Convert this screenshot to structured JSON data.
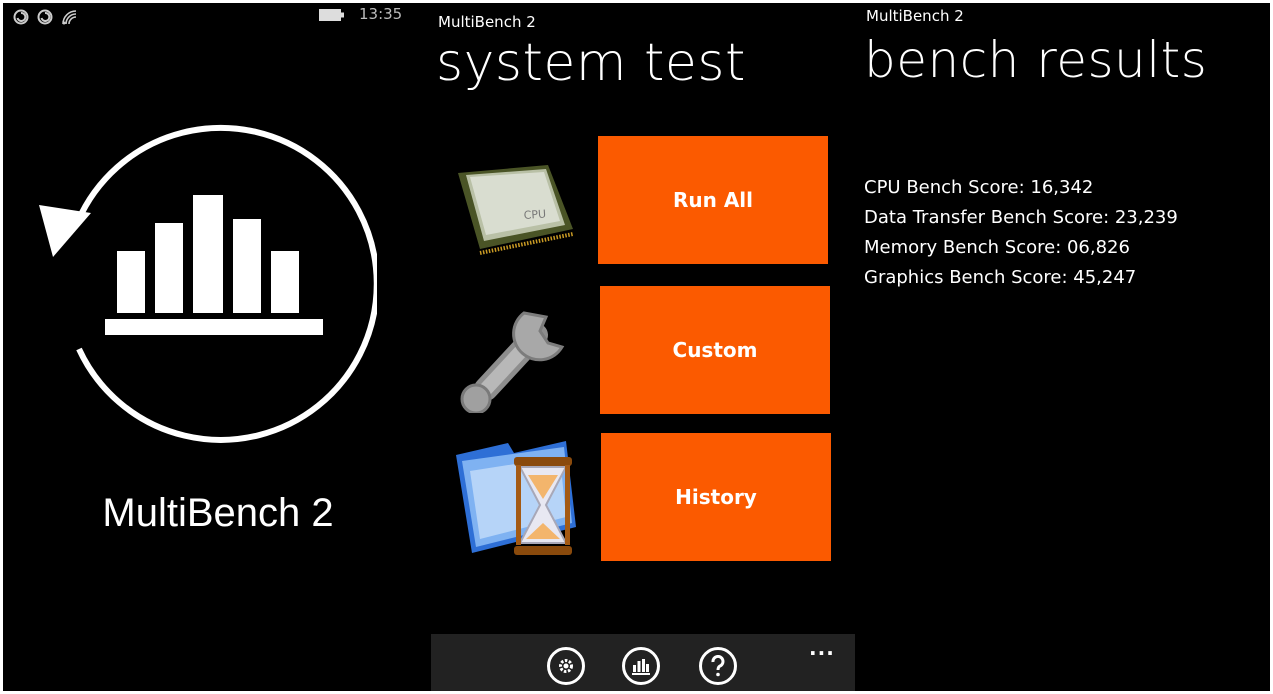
{
  "splash": {
    "status_bar": {
      "time": "13:35",
      "icons": [
        "notification-icon",
        "notification-icon",
        "signal-icon",
        "battery-icon"
      ]
    },
    "logo_icon": "refresh-bar-chart-icon",
    "app_title": "MultiBench 2"
  },
  "system_test": {
    "app_name": "MultiBench 2",
    "title": "system test",
    "tiles": [
      {
        "label": "Run All",
        "icon": "cpu-chip-icon"
      },
      {
        "label": "Custom",
        "icon": "wrench-icon"
      },
      {
        "label": "History",
        "icon": "folder-hourglass-icon"
      }
    ],
    "app_bar": {
      "buttons": [
        "settings-icon",
        "chart-icon",
        "help-icon"
      ],
      "more": "..."
    },
    "colors": {
      "tile": "#fb5a00",
      "app_bar": "#222222"
    }
  },
  "bench_results": {
    "app_name": "MultiBench 2",
    "title": "bench results",
    "scores": [
      "CPU Bench Score: 16,342",
      "Data Transfer Bench Score: 23,239",
      "Memory Bench Score: 06,826",
      "Graphics Bench Score: 45,247"
    ]
  }
}
